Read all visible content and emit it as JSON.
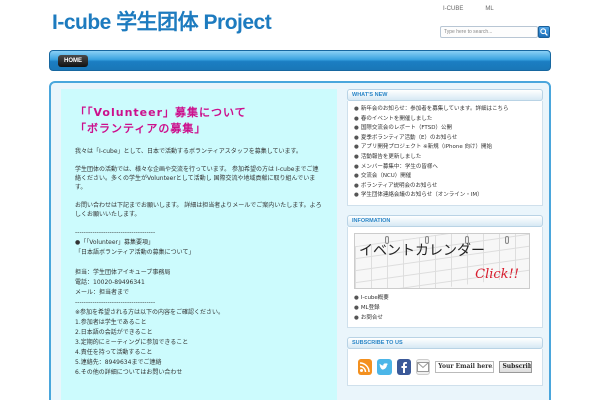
{
  "header": {
    "site_title": "I-cube 学生团体 Project",
    "top_links": [
      "I-CUBE",
      "ML"
    ],
    "search_placeholder": "Type here to search..."
  },
  "nav": {
    "home_label": "HOME"
  },
  "post": {
    "title_line1": "「「Volunteer」募集について",
    "title_line2": "「ボランティアの募集」",
    "paragraphs": [
      "我々は「I-cube」として、日本で活動するボランティアスタッフを募集しています。",
      "学生団体の活動では、様々な企画や交流を行っています。 参加希望の方は I-cubeまでご連絡ください。多くの学生がVolunteerとして活動し 国際交流や地域貢献に取り組んでいます。",
      "お問い合わせは下記までお願いします。 詳細は担当者よりメールでご案内いたします。よろしくお願いいたします。"
    ],
    "lines": [
      "-------------------------------------",
      "●「「Volunteer」募集要項」",
      "「日本語ボランティア活動の募集について」",
      "",
      "担当：学生団体アイキューブ事務局",
      "電話：10020-89496341",
      "メール：担当者まで",
      "-------------------------------------",
      "※参加を希望される方は以下の内容をご確認ください。",
      "1.参加者は学生であること",
      "2.日本語の会話ができること",
      "3.定期的にミーティングに参加できること",
      "4.責任を持って活動すること",
      "5.連絡先：8949634までご連絡",
      "6.その他の詳細についてはお問い合わせ"
    ]
  },
  "sidebar": {
    "news": {
      "heading": "WHAT'S NEW",
      "items": [
        "新年会のお知らせ：参加者を募集しています。詳細はこちら",
        "春のイベントを開催しました",
        "国際交流会のレポート（FTSD）公開",
        "夏季ボランティア活動（E）のお知らせ",
        "アプリ開発プロジェクト ※新規（iPhone 向け）開始",
        "活動報告を更新しました",
        "メンバー募集中：学生の皆様へ",
        "交流会（NCU）開催",
        "ボランティア説明会のお知らせ",
        "学生団体連絡会議のお知らせ（オンライン・IM）"
      ]
    },
    "info": {
      "heading": "INFORMATION",
      "banner_title": "イベントカレンダー",
      "banner_click": "Click!!",
      "items": [
        "I-cube概要",
        "ML登録",
        "お問合せ"
      ]
    },
    "subscribe": {
      "heading": "SUBSCRIBE TO US",
      "email_placeholder": "Your Email here...",
      "button_label": "Subscribe"
    }
  }
}
